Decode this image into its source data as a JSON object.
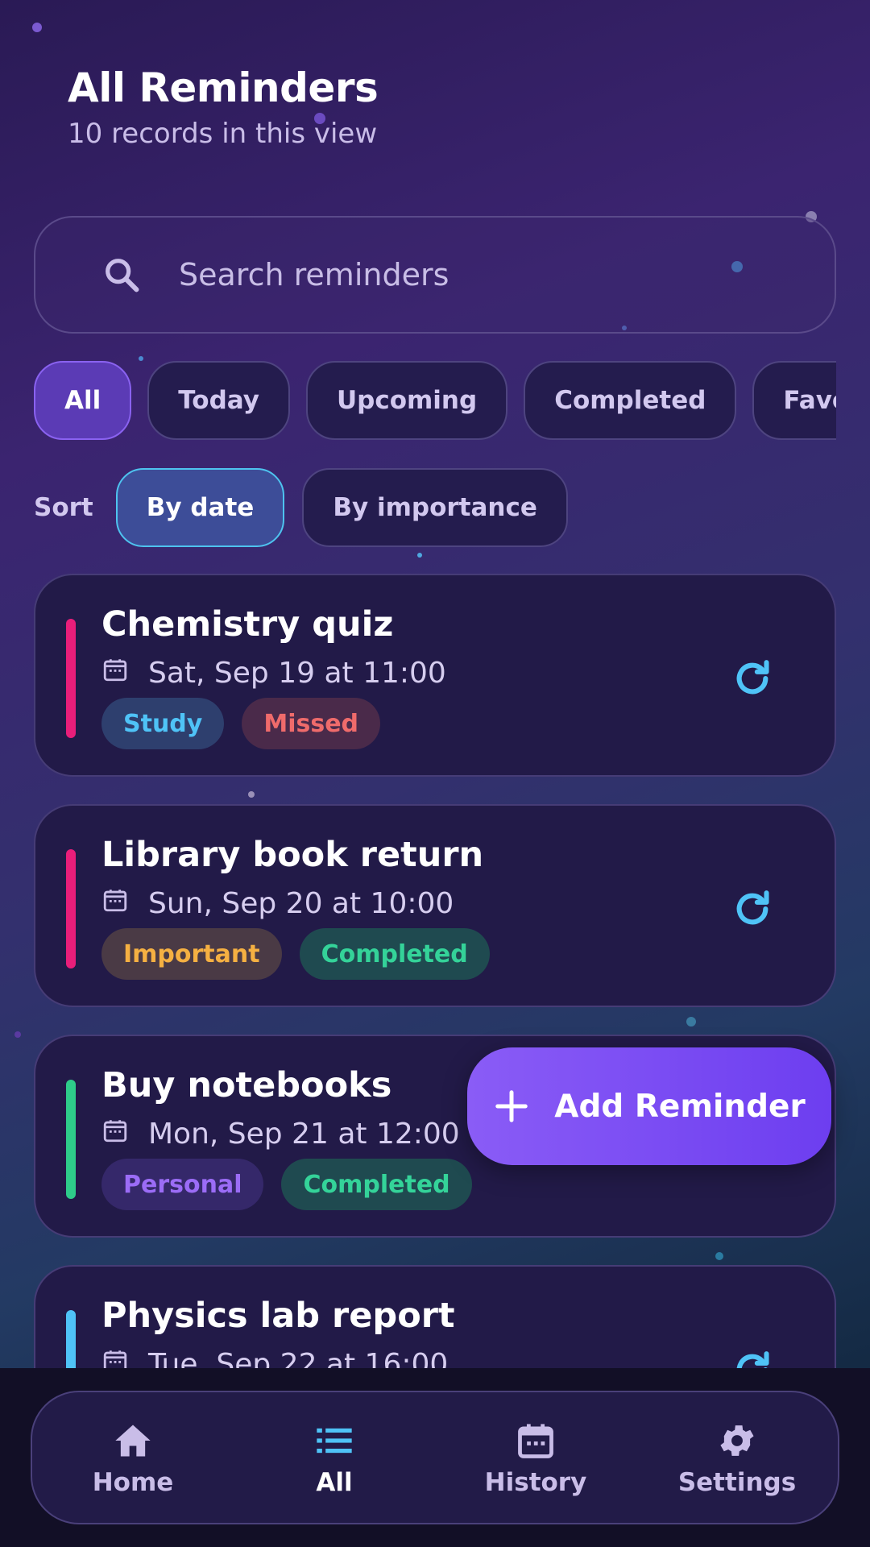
{
  "header": {
    "title": "All Reminders",
    "subtitle": "10 records in this view"
  },
  "search": {
    "placeholder": "Search reminders",
    "icon": "search-icon"
  },
  "filters": [
    {
      "label": "All",
      "active": true
    },
    {
      "label": "Today",
      "active": false
    },
    {
      "label": "Upcoming",
      "active": false
    },
    {
      "label": "Completed",
      "active": false
    },
    {
      "label": "Favorites",
      "active": false
    }
  ],
  "sort": {
    "label": "Sort",
    "options": [
      {
        "label": "By date",
        "active": true
      },
      {
        "label": "By importance",
        "active": false
      }
    ]
  },
  "reminders": [
    {
      "title": "Chemistry quiz",
      "date": "Sat, Sep 19 at 11:00",
      "accent": "#e91e7a",
      "tags": [
        {
          "label": "Study",
          "bg": "#2e3f6e",
          "fg": "#4fc3f7"
        },
        {
          "label": "Missed",
          "bg": "#4a2a4a",
          "fg": "#ef6b6b"
        }
      ],
      "repeat_icon": "repeat-icon"
    },
    {
      "title": "Library book return",
      "date": "Sun, Sep 20 at 10:00",
      "accent": "#e91e7a",
      "tags": [
        {
          "label": "Important",
          "bg": "#4a3a45",
          "fg": "#f5b042"
        },
        {
          "label": "Completed",
          "bg": "#1f4a50",
          "fg": "#34d399"
        }
      ],
      "repeat_icon": "repeat-icon"
    },
    {
      "title": "Buy notebooks",
      "date": "Mon, Sep 21 at 12:00",
      "accent": "#2ecc8a",
      "tags": [
        {
          "label": "Personal",
          "bg": "#35286a",
          "fg": "#9b6cf6"
        },
        {
          "label": "Completed",
          "bg": "#1f4a50",
          "fg": "#34d399"
        }
      ],
      "repeat_icon": null
    },
    {
      "title": "Physics lab report",
      "date": "Tue, Sep 22 at 16:00",
      "accent": "#4fc3f7",
      "tags": [],
      "repeat_icon": "repeat-icon"
    }
  ],
  "fab": {
    "label": "Add Reminder",
    "icon": "plus-icon"
  },
  "nav": [
    {
      "label": "Home",
      "icon": "home-icon",
      "active": false
    },
    {
      "label": "All",
      "icon": "list-icon",
      "active": true
    },
    {
      "label": "History",
      "icon": "calendar-icon",
      "active": false
    },
    {
      "label": "Settings",
      "icon": "gear-icon",
      "active": false
    }
  ],
  "colors": {
    "accent_purple": "#7c4dff",
    "accent_cyan": "#4fc3f7"
  }
}
